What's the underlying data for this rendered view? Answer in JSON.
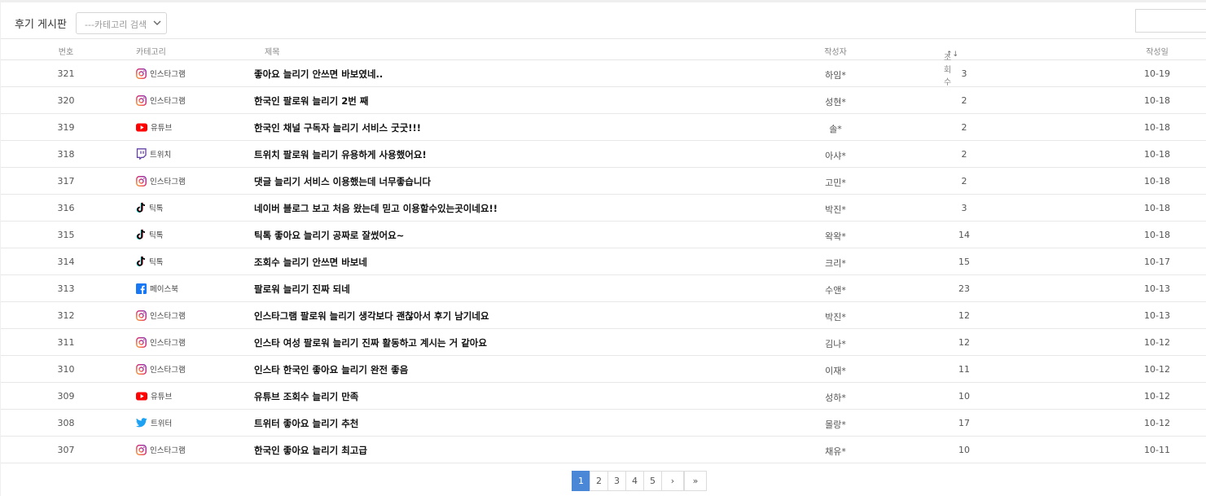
{
  "board": {
    "title": "후기 게시판",
    "category_select": {
      "selected": "---카테고리 검색"
    },
    "search": {
      "value": ""
    }
  },
  "table": {
    "headers": {
      "num": "번호",
      "category": "카테고리",
      "title": "제목",
      "author": "작성자",
      "views": "조회수",
      "views_sort": "↑↓",
      "date": "작성일"
    },
    "rows": [
      {
        "num": "321",
        "category": "인스타그램",
        "icon": "instagram-icon",
        "title": "좋아요 늘리기 안쓰면 바보였네..",
        "author": "하임*",
        "views": "3",
        "date": "10-19"
      },
      {
        "num": "320",
        "category": "인스타그램",
        "icon": "instagram-icon",
        "title": "한국인 팔로워 늘리기 2번 째",
        "author": "성현*",
        "views": "2",
        "date": "10-18"
      },
      {
        "num": "319",
        "category": "유튜브",
        "icon": "youtube-icon",
        "title": "한국인 채널 구독자 늘리기 서비스 굿굿!!!",
        "author": "솔*",
        "views": "2",
        "date": "10-18"
      },
      {
        "num": "318",
        "category": "트위치",
        "icon": "twitch-icon",
        "title": "트위치 팔로워 늘리기 유용하게 사용했어요!",
        "author": "아샤*",
        "views": "2",
        "date": "10-18"
      },
      {
        "num": "317",
        "category": "인스타그램",
        "icon": "instagram-icon",
        "title": "댓글 늘리기 서비스 이용했는데 너무좋습니다",
        "author": "고민*",
        "views": "2",
        "date": "10-18"
      },
      {
        "num": "316",
        "category": "틱톡",
        "icon": "tiktok-icon",
        "title": "네이버 블로그 보고 처음 왔는데 믿고 이용할수있는곳이네요!!",
        "author": "박진*",
        "views": "3",
        "date": "10-18"
      },
      {
        "num": "315",
        "category": "틱톡",
        "icon": "tiktok-icon",
        "title": "틱톡 좋아요 늘리기 공짜로 잘썼어요~",
        "author": "왁왁*",
        "views": "14",
        "date": "10-18"
      },
      {
        "num": "314",
        "category": "틱톡",
        "icon": "tiktok-icon",
        "title": "조회수 늘리기 안쓰면 바보네",
        "author": "크리*",
        "views": "15",
        "date": "10-17"
      },
      {
        "num": "313",
        "category": "페이스북",
        "icon": "facebook-icon",
        "title": "팔로워 늘리기 진짜 되네",
        "author": "수앤*",
        "views": "23",
        "date": "10-13"
      },
      {
        "num": "312",
        "category": "인스타그램",
        "icon": "instagram-icon",
        "title": "인스타그램 팔로워 늘리기 생각보다 괜찮아서 후기 남기네요",
        "author": "박진*",
        "views": "12",
        "date": "10-13"
      },
      {
        "num": "311",
        "category": "인스타그램",
        "icon": "instagram-icon",
        "title": "인스타 여성 팔로워 늘리기 진짜 활동하고 계시는 거 같아요",
        "author": "김나*",
        "views": "12",
        "date": "10-12"
      },
      {
        "num": "310",
        "category": "인스타그램",
        "icon": "instagram-icon",
        "title": "인스타 한국인 좋아요 늘리기 완전 좋음",
        "author": "이재*",
        "views": "11",
        "date": "10-12"
      },
      {
        "num": "309",
        "category": "유튜브",
        "icon": "youtube-icon",
        "title": "유튜브 조회수 늘리기 만족",
        "author": "성하*",
        "views": "10",
        "date": "10-12"
      },
      {
        "num": "308",
        "category": "트위터",
        "icon": "twitter-icon",
        "title": "트위터 좋아요 늘리기 추천",
        "author": "몰랑*",
        "views": "17",
        "date": "10-12"
      },
      {
        "num": "307",
        "category": "인스타그램",
        "icon": "instagram-icon",
        "title": "한국인 좋아요 늘리기 최고급",
        "author": "채유*",
        "views": "10",
        "date": "10-11"
      }
    ]
  },
  "pagination": {
    "pages": [
      "1",
      "2",
      "3",
      "4",
      "5"
    ],
    "current": "1",
    "next": "›",
    "last": "»"
  },
  "colors": {
    "accent": "#4a87d6",
    "youtube": "#ff0000",
    "twitch": "#6441a5",
    "facebook": "#1877f2",
    "twitter": "#1da1f2"
  }
}
